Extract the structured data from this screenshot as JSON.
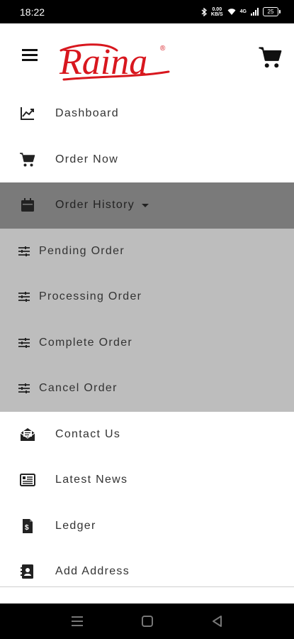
{
  "status_bar": {
    "time": "18:22",
    "net_speed_value": "0.00",
    "net_speed_unit": "KB/S",
    "network_type": "4G",
    "battery": "25"
  },
  "header": {
    "logo_text": "Raina",
    "logo_mark": "®",
    "brand_color": "#d8171e"
  },
  "menu": {
    "items": [
      {
        "label": "Dashboard",
        "icon": "chart-line-icon"
      },
      {
        "label": "Order Now",
        "icon": "cart-icon"
      },
      {
        "label": "Order History",
        "icon": "calendar-icon",
        "expanded": true
      },
      {
        "label": "Contact Us",
        "icon": "mail-open-icon"
      },
      {
        "label": "Latest News",
        "icon": "newspaper-icon"
      },
      {
        "label": "Ledger",
        "icon": "invoice-icon"
      },
      {
        "label": "Add Address",
        "icon": "contact-book-icon"
      }
    ],
    "sub_items": [
      {
        "label": "Pending Order",
        "icon": "sliders-icon"
      },
      {
        "label": "Processing Order",
        "icon": "sliders-icon"
      },
      {
        "label": "Complete Order",
        "icon": "sliders-icon"
      },
      {
        "label": "Cancel Order",
        "icon": "sliders-icon"
      }
    ]
  },
  "colors": {
    "active_item_bg": "#7a7a7a",
    "submenu_bg": "#bdbdbd"
  }
}
